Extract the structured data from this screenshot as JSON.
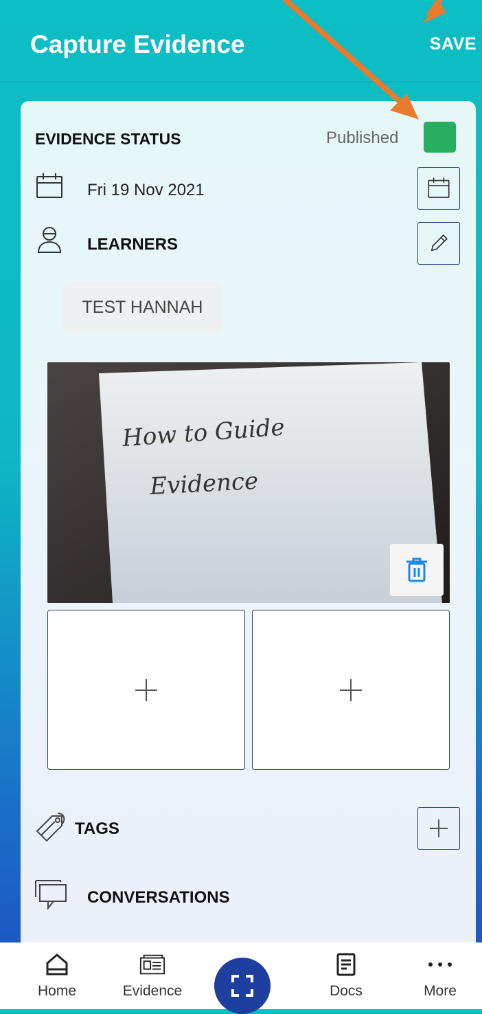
{
  "appbar": {
    "title": "Capture Evidence",
    "save_label": "SAVE"
  },
  "status": {
    "label": "EVIDENCE STATUS",
    "value": "Published",
    "color": "#27ae60"
  },
  "date": {
    "text": "Fri 19 Nov 2021"
  },
  "learners": {
    "label": "LEARNERS",
    "chips": [
      "TEST HANNAH"
    ]
  },
  "photo": {
    "handwriting_line1": "How to Guide",
    "handwriting_line2": "Evidence"
  },
  "add_tiles": [
    "+",
    "+"
  ],
  "tags": {
    "label": "TAGS"
  },
  "conversations": {
    "label": "CONVERSATIONS"
  },
  "nav": {
    "items": [
      {
        "label": "Home",
        "icon": "home-icon"
      },
      {
        "label": "Evidence",
        "icon": "evidence-icon"
      },
      {
        "label": "Scan",
        "icon": "scan-icon"
      },
      {
        "label": "Docs",
        "icon": "docs-icon"
      },
      {
        "label": "More",
        "icon": "more-icon"
      }
    ]
  },
  "colors": {
    "accent": "#0cbfc4",
    "navy": "#1e3a78",
    "published": "#27ae60",
    "trash": "#1e88e5",
    "annotation_arrow": "#ea7a2e"
  }
}
